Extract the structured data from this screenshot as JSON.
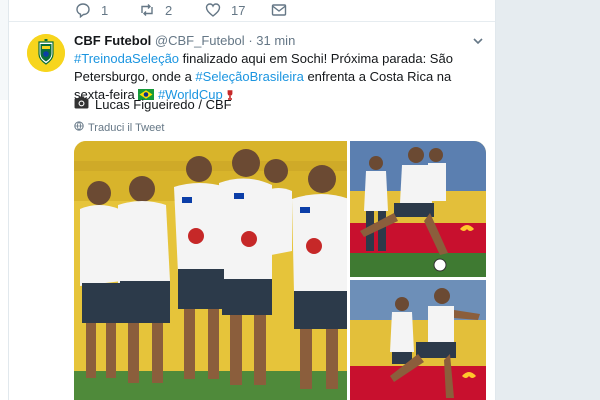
{
  "previous_tweet": {
    "reply_count": "1",
    "retweet_count": "2",
    "like_count": "17"
  },
  "tweet": {
    "display_name": "CBF Futebol",
    "handle": "@CBF_Futebol",
    "separator": "·",
    "time": "31 min",
    "text_parts": {
      "hashtag1": "#TreinodaSeleção",
      "t1": " finalizado aqui em Sochi! Próxima parada: São Petersburgo, onde a ",
      "hashtag2": "#SeleçãoBrasileira",
      "t2": " enfrenta a Costa Rica na sexta-feira ",
      "hashtag3": "#WorldCup"
    },
    "photo_credit": "Lucas Figueiredo / CBF",
    "translate_label": "Traduci il Tweet",
    "avatar_text": "BRASIL"
  },
  "icons": {
    "reply": "reply-icon",
    "retweet": "retweet-icon",
    "like": "heart-icon",
    "dm": "envelope-icon",
    "camera": "camera-icon",
    "globe": "globe-icon",
    "chevron": "chevron-down-icon"
  },
  "colors": {
    "link": "#1b95e0",
    "text": "#14171a",
    "muted": "#657786",
    "background": "#e6ecf0"
  }
}
